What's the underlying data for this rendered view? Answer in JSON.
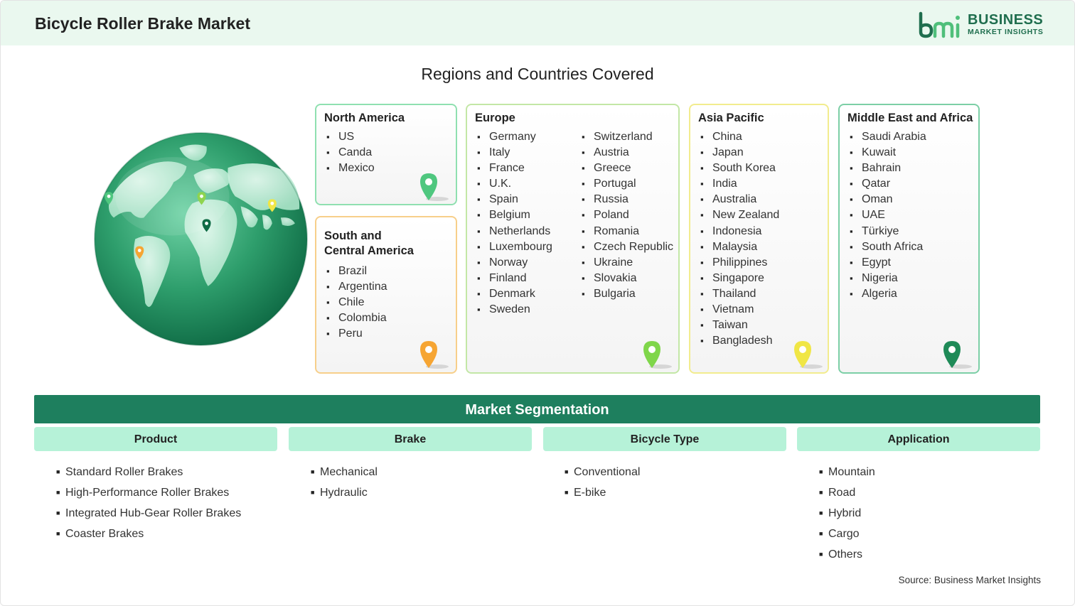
{
  "header": {
    "title": "Bicycle Roller Brake Market",
    "logo_line1": "BUSINESS",
    "logo_line2": "MARKET INSIGHTS"
  },
  "regions_title": "Regions and Countries Covered",
  "regions": {
    "north_america": {
      "name": "North America",
      "accent": "#4fc77f",
      "countries": [
        "US",
        "Canda",
        "Mexico"
      ]
    },
    "south_central_america": {
      "name_line1": "South and",
      "name_line2": "Central America",
      "accent": "#f6a533",
      "countries": [
        "Brazil",
        "Argentina",
        "Chile",
        "Colombia",
        "Peru"
      ]
    },
    "europe": {
      "name": "Europe",
      "accent": "#7fd64a",
      "countries_col1": [
        "Germany",
        "Italy",
        "France",
        "U.K.",
        "Spain",
        "Belgium",
        "Netherlands",
        "Luxembourg",
        "Norway",
        "Finland",
        "Denmark",
        "Sweden"
      ],
      "countries_col2": [
        "Switzerland",
        "Austria",
        "Greece",
        "Portugal",
        "Russia",
        "Poland",
        "Romania",
        "Czech Republic",
        "Ukraine",
        "Slovakia",
        "Bulgaria"
      ]
    },
    "asia_pacific": {
      "name": "Asia Pacific",
      "accent": "#f0e645",
      "countries": [
        "China",
        "Japan",
        "South Korea",
        "India",
        "Australia",
        "New Zealand",
        "Indonesia",
        "Malaysia",
        "Philippines",
        "Singapore",
        "Thailand",
        "Vietnam",
        "Taiwan",
        "Bangladesh"
      ]
    },
    "middle_east_africa": {
      "name": "Middle East and Africa",
      "accent": "#1e8a57",
      "countries": [
        "Saudi Arabia",
        "Kuwait",
        "Bahrain",
        "Qatar",
        "Oman",
        "UAE",
        "Türkiye",
        "South Africa",
        "Egypt",
        "Nigeria",
        "Algeria"
      ]
    }
  },
  "segmentation": {
    "title": "Market Segmentation",
    "product": {
      "label": "Product",
      "items": [
        "Standard Roller Brakes",
        "High-Performance Roller Brakes",
        "Integrated Hub-Gear Roller Brakes",
        "Coaster Brakes"
      ]
    },
    "brake": {
      "label": "Brake",
      "items": [
        "Mechanical",
        "Hydraulic"
      ]
    },
    "bicycle_type": {
      "label": "Bicycle Type",
      "items": [
        "Conventional",
        "E-bike"
      ]
    },
    "application": {
      "label": "Application",
      "items": [
        "Mountain",
        "Road",
        "Hybrid",
        "Cargo",
        "Others"
      ]
    }
  },
  "source": "Source: Business Market Insights",
  "colors": {
    "header_bg": "#eaf8ef",
    "brand_green": "#1e7f5e",
    "segment_head_bg": "#b6f2d8"
  }
}
